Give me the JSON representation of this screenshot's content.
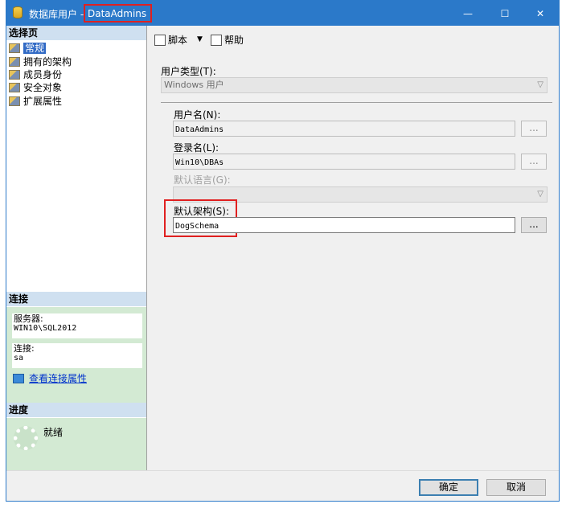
{
  "window": {
    "title_prefix": "数据库用户 - ",
    "title_name": "DataAdmins",
    "controls": {
      "minimize": "—",
      "maximize": "☐",
      "close": "✕"
    }
  },
  "left": {
    "select_page_header": "选择页",
    "pages": [
      {
        "label": "常规",
        "selected": true
      },
      {
        "label": "拥有的架构",
        "selected": false
      },
      {
        "label": "成员身份",
        "selected": false
      },
      {
        "label": "安全对象",
        "selected": false
      },
      {
        "label": "扩展属性",
        "selected": false
      }
    ],
    "connection_header": "连接",
    "server_label": "服务器:",
    "server_value": "WIN10\\SQL2012",
    "connection_label": "连接:",
    "connection_value": "sa",
    "view_props_link": "查看连接属性",
    "progress_header": "进度",
    "progress_status": "就绪"
  },
  "toolbar": {
    "script_label": "脚本",
    "dropdown_arrow": "▼",
    "help_label": "帮助"
  },
  "form": {
    "user_type_label": "用户类型(T):",
    "user_type_value": "Windows 用户",
    "user_name_label": "用户名(N):",
    "user_name_value": "DataAdmins",
    "login_name_label": "登录名(L):",
    "login_name_value": "Win10\\DBAs",
    "default_language_label": "默认语言(G):",
    "default_language_value": "",
    "default_schema_label": "默认架构(S):",
    "default_schema_value": "DogSchema",
    "browse_label": "..."
  },
  "buttons": {
    "ok": "确定",
    "cancel": "取消"
  },
  "colors": {
    "titlebar": "#2b79c9",
    "highlight": "#e02020",
    "panel_green": "#d3ead3"
  }
}
